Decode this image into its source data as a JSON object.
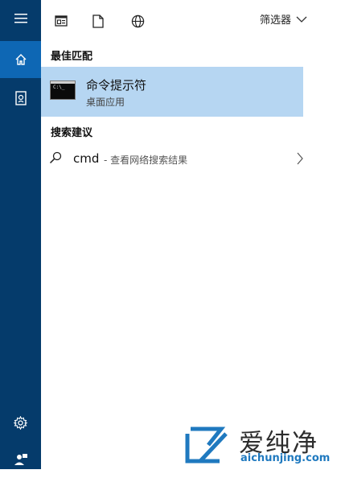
{
  "sidebar": {
    "items": [
      {
        "name": "menu",
        "icon": "hamburger-icon"
      },
      {
        "name": "home",
        "icon": "home-icon",
        "selected": true
      },
      {
        "name": "notebook",
        "icon": "notebook-icon"
      },
      {
        "name": "settings",
        "icon": "gear-icon"
      },
      {
        "name": "feedback",
        "icon": "feedback-icon"
      }
    ],
    "background": "#053b6b",
    "selected_color": "#0e67b4"
  },
  "toolbar": {
    "icons": [
      "app-window-icon",
      "document-icon",
      "globe-icon"
    ],
    "filter_label": "筛选器"
  },
  "best_match": {
    "section_title": "最佳匹配",
    "item": {
      "name": "命令提示符",
      "subtitle": "桌面应用",
      "icon": "cmd-icon",
      "highlight": "#b6d6f2"
    }
  },
  "suggestions": {
    "section_title": "搜索建议",
    "items": [
      {
        "query": "cmd",
        "description": "- 查看网络搜索结果"
      }
    ]
  },
  "watermark": {
    "title": "爱纯净",
    "url": "aichunjing.com"
  }
}
